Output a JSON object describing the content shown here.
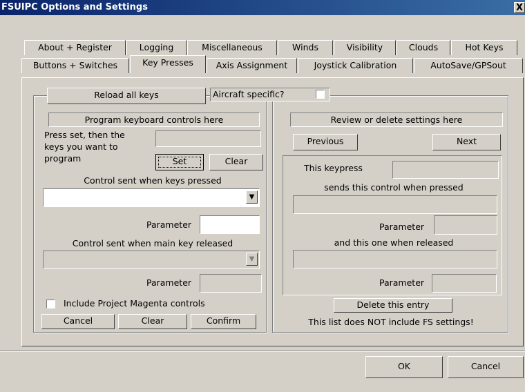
{
  "window": {
    "title": "FSUIPC Options and Settings",
    "close_label": "X"
  },
  "tabs_row1": [
    "About + Register",
    "Logging",
    "Miscellaneous",
    "Winds",
    "Visibility",
    "Clouds",
    "Hot Keys"
  ],
  "tabs_row2": [
    "Buttons + Switches",
    "Key Presses",
    "Axis Assignment",
    "Joystick Calibration",
    "AutoSave/GPSout"
  ],
  "active_tab": "Key Presses",
  "top": {
    "reload_label": "Reload all keys",
    "aircraft_specific_label": "Aircraft specific?",
    "aircraft_specific_checked": false
  },
  "left": {
    "header": "Program keyboard controls here",
    "press_set_text": [
      "Press set, then the",
      "keys you want to",
      "program"
    ],
    "keys_value": "",
    "set_label": "Set",
    "clear_label": "Clear",
    "control_pressed_label": "Control sent when keys pressed",
    "control_pressed_value": "",
    "parameter_label": "Parameter",
    "parameter_value": "",
    "control_released_label": "Control sent when main key released",
    "control_released_value": "",
    "parameter2_label": "Parameter",
    "parameter2_value": "",
    "magenta_label": "Include Project Magenta controls",
    "magenta_checked": false,
    "cancel_label": "Cancel",
    "clear2_label": "Clear",
    "confirm_label": "Confirm"
  },
  "right": {
    "header": "Review or delete settings here",
    "previous_label": "Previous",
    "next_label": "Next",
    "keypress_label": "This keypress",
    "keypress_value": "",
    "sends_label": "sends this control when pressed",
    "sends_value": "",
    "parameter_label": "Parameter",
    "parameter_value": "",
    "released_label": "and this one when released",
    "released_value": "",
    "parameter2_label": "Parameter",
    "parameter2_value": "",
    "delete_label": "Delete this entry",
    "note": "This list does NOT include FS settings!"
  },
  "footer": {
    "ok_label": "OK",
    "cancel_label": "Cancel"
  }
}
